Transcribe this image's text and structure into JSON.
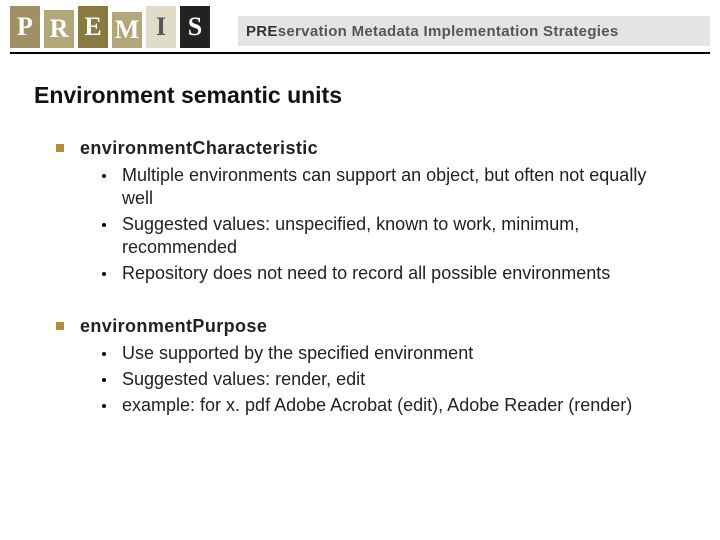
{
  "header": {
    "logo_letters": [
      "P",
      "R",
      "E",
      "M",
      "I",
      "S"
    ],
    "tagline_emph": "PRE",
    "tagline_rest": "servation Metadata Implementation Strategies"
  },
  "title": "Environment semantic units",
  "items": [
    {
      "label": "environmentCharacteristic",
      "bullets": [
        "Multiple environments can support an object, but often not equally well",
        "Suggested values: unspecified, known to work, minimum, recommended",
        "Repository does not need to record all possible environments"
      ]
    },
    {
      "label": "environmentPurpose",
      "bullets": [
        "Use supported by the specified environment",
        "Suggested values: render, edit",
        "example: for x. pdf Adobe Acrobat (edit), Adobe Reader (render)"
      ]
    }
  ]
}
